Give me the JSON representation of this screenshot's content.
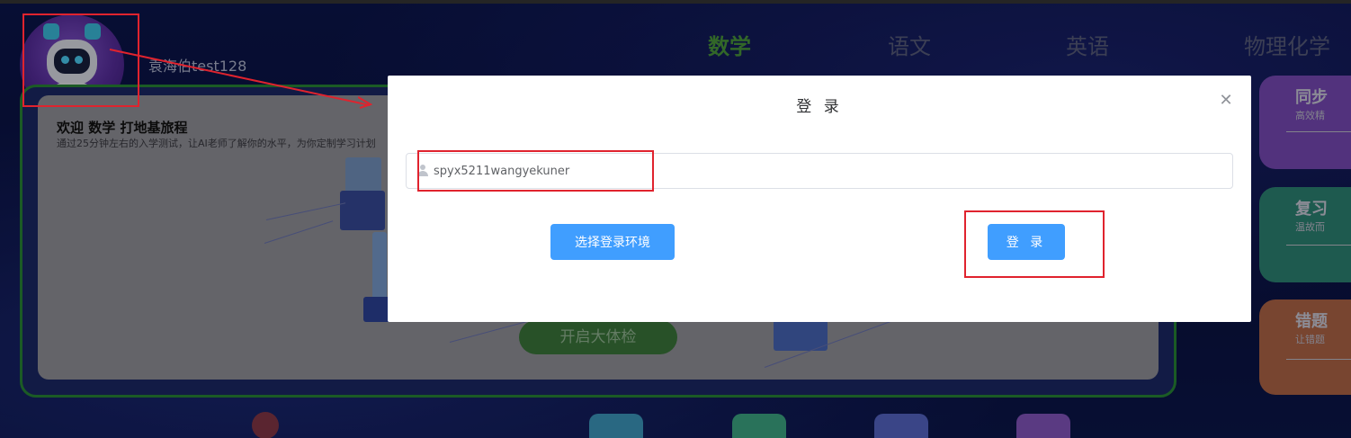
{
  "user": {
    "name": "袁海伯test128"
  },
  "subjects": [
    "数学",
    "语文",
    "英语",
    "物理化学"
  ],
  "active_subject_index": 0,
  "card": {
    "title": "欢迎 数学 打地基旅程",
    "subtitle": "通过25分钟左右的入学测试，让AI老师了解你的水平，为你定制学习计划",
    "start_button": "开启大体检"
  },
  "side_cards": [
    {
      "title": "同步",
      "subtitle": "高效精"
    },
    {
      "title": "复习",
      "subtitle": "温故而"
    },
    {
      "title": "错题",
      "subtitle": "让错题"
    }
  ],
  "modal": {
    "title": "登 录",
    "close_icon": "close-icon",
    "username_value": "spyx5211wangyekuner",
    "env_button": "选择登录环境",
    "login_button": "登 录"
  },
  "colors": {
    "primary": "#409eff",
    "active_tab": "#4e9e3e",
    "annotation_red": "#e0232e"
  }
}
